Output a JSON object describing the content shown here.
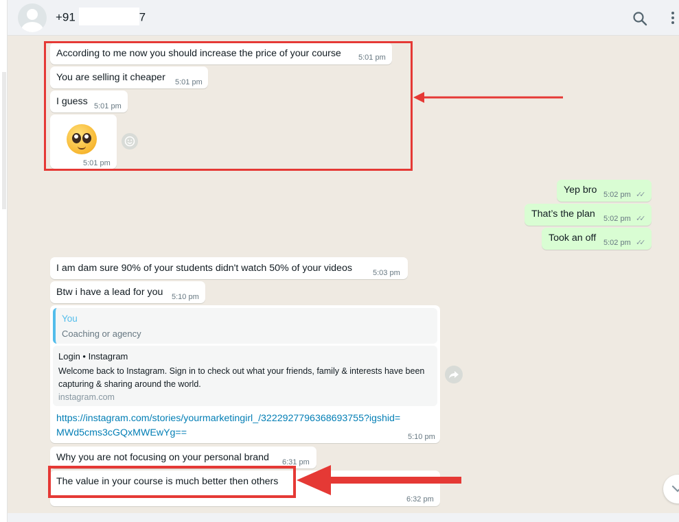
{
  "header": {
    "contact_prefix": "+91",
    "contact_suffix": "7",
    "search_icon": "search-icon",
    "menu_icon": "kebab-menu-icon"
  },
  "messages": [
    {
      "dir": "in",
      "text": "According to me now you should increase the price of your course",
      "time": "5:01 pm"
    },
    {
      "dir": "in",
      "text": "You are selling it cheaper",
      "time": "5:01 pm"
    },
    {
      "dir": "in",
      "text": "I guess",
      "time": "5:01 pm"
    },
    {
      "dir": "in",
      "type": "emoji",
      "emoji_name": "pleading-face-emoji",
      "time": "5:01 pm"
    },
    {
      "dir": "out",
      "text": "Yep bro",
      "time": "5:02 pm",
      "status": "read"
    },
    {
      "dir": "out",
      "text": "That’s the plan",
      "time": "5:02 pm",
      "status": "read"
    },
    {
      "dir": "out",
      "text": "Took an off",
      "time": "5:02 pm",
      "status": "read"
    },
    {
      "dir": "in",
      "text": "I am dam sure 90% of your students didn't watch 50% of your videos",
      "time": "5:03 pm"
    },
    {
      "dir": "in",
      "text": "Btw i have a lead for you",
      "time": "5:10 pm"
    },
    {
      "dir": "in",
      "type": "link",
      "quote_author": "You",
      "quote_text": "Coaching or agency",
      "preview_title": "Login • Instagram",
      "preview_desc": "Welcome back to Instagram. Sign in to check out what your friends, family & interests have been capturing & sharing around the world.",
      "preview_domain": "instagram.com",
      "url": "https://instagram.com/stories/yourmarketingirl_/3222927796368693755?igshid=MWd5cms3cGQxMWEwYg==",
      "time": "5:10 pm"
    },
    {
      "dir": "in",
      "text": "Why you are not focusing on your personal brand",
      "time": "6:31 pm"
    },
    {
      "dir": "in",
      "text": "The value in your course is much better then others",
      "time": "6:32 pm"
    }
  ],
  "colors": {
    "annotation": "#e53935",
    "outgoing_bubble": "#d9fdd3",
    "incoming_bubble": "#ffffff",
    "link": "#027eb5",
    "quote_accent": "#53bdeb",
    "wallpaper": "#efeae2"
  }
}
